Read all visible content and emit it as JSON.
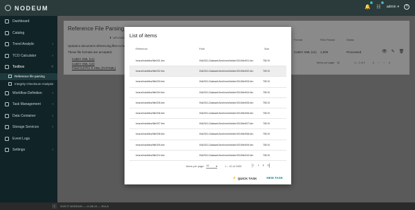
{
  "app": {
    "brand": "NODEUM"
  },
  "topbar": {
    "notif_badge": "1",
    "tasks_badge": "1",
    "user": "admin",
    "help_glyph": "?"
  },
  "sidebar": {
    "items": [
      {
        "label": "Dashboard",
        "chevron": ""
      },
      {
        "label": "Catalog",
        "chevron": ""
      },
      {
        "label": "Trend Analytic",
        "chevron": "‹"
      },
      {
        "label": "TCO Calculator",
        "chevron": "‹"
      },
      {
        "label": "Toolbox",
        "chevron": "˅"
      },
      {
        "label": "Workflow Definition",
        "chevron": "‹"
      },
      {
        "label": "Task Management",
        "chevron": "‹"
      },
      {
        "label": "Data Container",
        "chevron": "‹"
      },
      {
        "label": "Storage Services",
        "chevron": "‹"
      },
      {
        "label": "Event Logs",
        "chevron": ""
      },
      {
        "label": "Settings",
        "chevron": "‹"
      }
    ],
    "sub_items": [
      {
        "label": "Reference file parsing"
      },
      {
        "label": "Integrity Checksum Analysis"
      }
    ]
  },
  "background": {
    "title": "Reference File Parsing",
    "upload_label": "UPLOAD RE",
    "text1": "Upload a document referencing files to be",
    "text2": "These file formats are accepted:",
    "formats": [
      "CatDV XML (v1)",
      "CatDV XML (v2)",
      "Final Cut Pro X XML (FCPXML)"
    ],
    "headers": {
      "format": "Format",
      "files_parsed": "Files Parsed",
      "status": "Status"
    },
    "row": {
      "format": "CatDV XML (v1)",
      "files_parsed": "1,000",
      "status": "Processed"
    },
    "pager": {
      "ipp": "Items per page:",
      "ipp_value": "10",
      "range": "1 – 1 of 1"
    }
  },
  "modal": {
    "title": "List of items",
    "headers": {
      "reference": "Reference",
      "path": "Path",
      "size": "Size"
    },
    "rows": [
      {
        "reference": "/mars/tototiles/file001.bin",
        "path": "/NAS01-Dataset/Archives/folder001/file001.bin",
        "size": "750 B"
      },
      {
        "reference": "/mars/tototiles/file002.bin",
        "path": "/NAS01-Dataset/Archives/folder001/file002.bin",
        "size": "750 B"
      },
      {
        "reference": "/mars/tototiles/file003.bin",
        "path": "/NAS01-Dataset/Archives/folder001/file003.bin",
        "size": "750 B"
      },
      {
        "reference": "/mars/tototiles/file004.bin",
        "path": "/NAS01-Dataset/Archives/folder001/file004.bin",
        "size": "750 B"
      },
      {
        "reference": "/mars/tototiles/file005.bin",
        "path": "/NAS01-Dataset/Archives/folder001/file005.bin",
        "size": "750 B"
      },
      {
        "reference": "/mars/tototiles/file006.bin",
        "path": "/NAS01-Dataset/Archives/folder001/file006.bin",
        "size": "750 B"
      },
      {
        "reference": "/mars/tototiles/file007.bin",
        "path": "/NAS01-Dataset/Archives/folder001/file007.bin",
        "size": "750 B"
      },
      {
        "reference": "/mars/tototiles/file008.bin",
        "path": "/NAS01-Dataset/Archives/folder001/file008.bin",
        "size": "750 B"
      },
      {
        "reference": "/mars/tototiles/file009.bin",
        "path": "/NAS01-Dataset/Archives/folder001/file009.bin",
        "size": "750 B"
      },
      {
        "reference": "/mars/tototiles/file010.bin",
        "path": "/NAS01-Dataset/Archives/folder001/file010.bin",
        "size": "750 B"
      }
    ],
    "pager": {
      "ipp": "Items per page:",
      "ipp_value": "10",
      "range": "1 – 10 of 1000"
    },
    "actions": {
      "quick_task": "QUICK TASK",
      "new_task": "NEW TASK"
    }
  },
  "footer": {
    "text": "2020 © NODEUM — v1.88.14 — EULA",
    "collapse_glyph": "‹"
  },
  "colors": {
    "accent": "#1e8b8b",
    "sidebar": "#102326",
    "topbar": "#2b3a3a"
  }
}
